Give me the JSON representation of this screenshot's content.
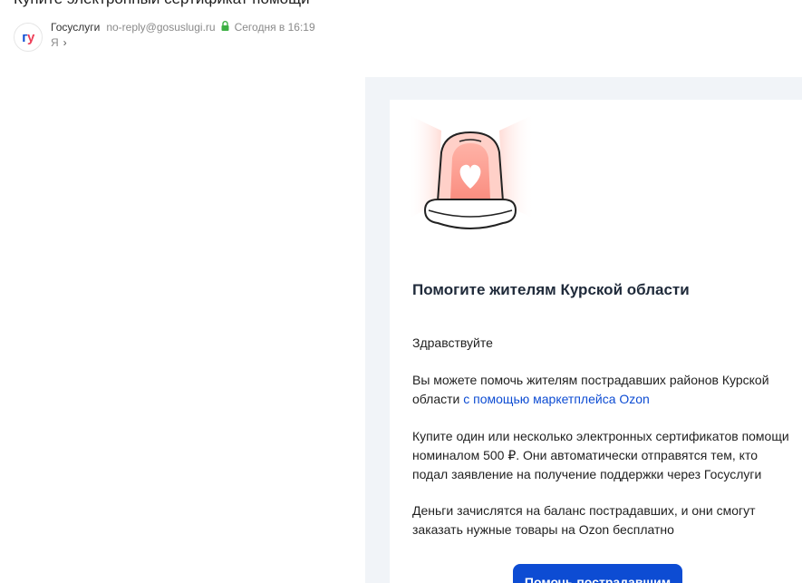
{
  "email": {
    "subject": "Купите электронный сертификат помощи",
    "avatar_text_g": "г",
    "avatar_text_u": "у",
    "sender_name": "Госуслуги",
    "sender_email": "no-reply@gosuslugi.ru",
    "date": "Сегодня в 16:19",
    "recipient": "Я",
    "recipient_chevron": "›"
  },
  "body": {
    "heading": "Помогите жителям Курской области",
    "greeting": "Здравствуйте",
    "p2_text": "Вы можете помочь жителям пострадавших районов Курской области ",
    "p2_link": "с помощью маркетплейса Ozon",
    "p3": "Купите один или несколько электронных сертификатов помощи номиналом 500 ₽. Они автоматически отправятся тем, кто подал заявление на получение поддержки через Госуслуги",
    "p4": "Деньги зачислятся на баланс пострадавших, и они смогут заказать нужные товары на Ozon бесплатно",
    "cta_label": "Помочь пострадавшим"
  },
  "colors": {
    "brand_blue": "#0d4cd3",
    "brand_red": "#ee3f58",
    "mail_background": "#f1f4f8",
    "secure_green": "#3cb043"
  },
  "icons": {
    "lock": "lock-icon",
    "siren": "siren-heart-icon",
    "chevron": "chevron-right-icon"
  }
}
